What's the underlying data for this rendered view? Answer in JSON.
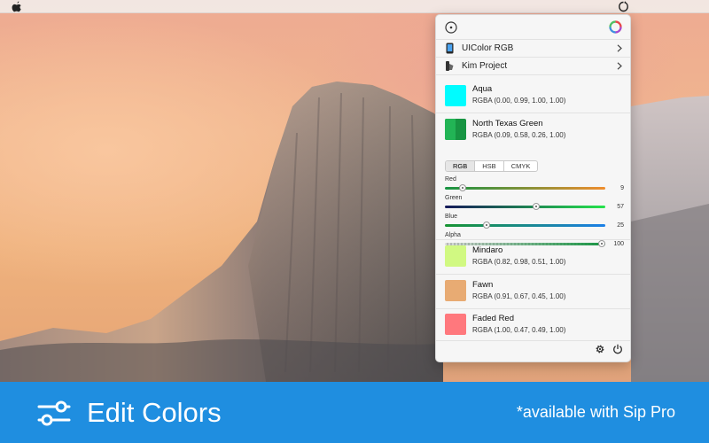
{
  "panel": {
    "rows": [
      {
        "label": "UIColor RGB",
        "icon": "phone-icon"
      },
      {
        "label": "Kim Project",
        "icon": "palette-icon"
      }
    ],
    "colors": [
      {
        "name": "Aqua",
        "value": "RGBA (0.00, 0.99, 1.00, 1.00)",
        "hex": "#00FCFF"
      },
      {
        "name": "North Texas Green",
        "value": "RGBA (0.09, 0.58, 0.26, 1.00)",
        "hex": "#179442"
      },
      {
        "name": "Mindaro",
        "value": "RGBA (0.82, 0.98, 0.51, 1.00)",
        "hex": "#D1F982"
      },
      {
        "name": "Fawn",
        "value": "RGBA (0.91, 0.67, 0.45, 1.00)",
        "hex": "#E8AB73"
      },
      {
        "name": "Faded Red",
        "value": "RGBA (1.00, 0.47, 0.49, 1.00)",
        "hex": "#FF787D"
      }
    ],
    "editor": {
      "modes": [
        "RGB",
        "HSB",
        "CMYK"
      ],
      "active_mode": "RGB",
      "sliders": [
        {
          "label": "Red",
          "value": "9",
          "fraction": 0.09
        },
        {
          "label": "Green",
          "value": "57",
          "fraction": 0.57
        },
        {
          "label": "Blue",
          "value": "25",
          "fraction": 0.25
        },
        {
          "label": "Alpha",
          "value": "100",
          "fraction": 1.0
        }
      ]
    }
  },
  "banner": {
    "title": "Edit Colors",
    "note": "*available with Sip Pro",
    "color": "#1F8EE0"
  }
}
